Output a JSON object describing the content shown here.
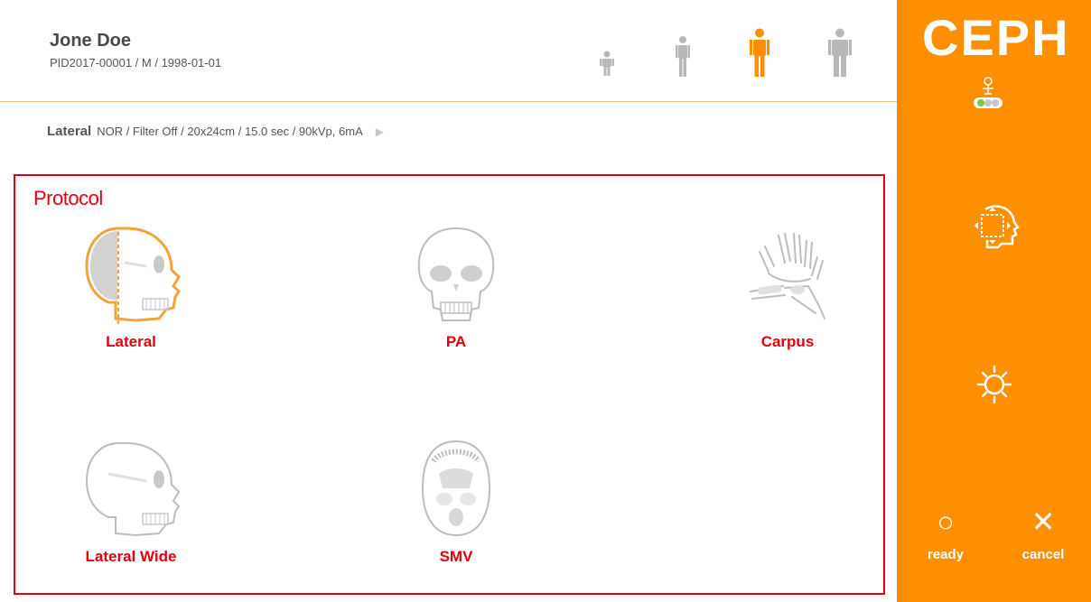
{
  "patient": {
    "name": "Jone Doe",
    "info": "PID2017-00001 / M / 1998-01-01"
  },
  "body_types": [
    {
      "name": "child",
      "selected": false
    },
    {
      "name": "small-adult",
      "selected": false
    },
    {
      "name": "adult",
      "selected": true
    },
    {
      "name": "large-adult",
      "selected": false
    }
  ],
  "exposure": {
    "mode": "Lateral",
    "details": "NOR / Filter Off / 20x24cm / 15.0 sec / 90kVp, 6mA",
    "arrow": "▶"
  },
  "protocol": {
    "title": "Protocol",
    "items": [
      {
        "label": "Lateral",
        "selected": true,
        "icon": "lateral-skull-icon"
      },
      {
        "label": "PA",
        "selected": false,
        "icon": "pa-skull-icon"
      },
      {
        "label": "Carpus",
        "selected": false,
        "icon": "hand-icon"
      },
      {
        "label": "Lateral Wide",
        "selected": false,
        "icon": "lateral-wide-skull-icon"
      },
      {
        "label": "SMV",
        "selected": false,
        "icon": "smv-skull-icon"
      }
    ]
  },
  "sidebar": {
    "mode_title": "CEPH",
    "ready_label": "ready",
    "cancel_label": "cancel",
    "ready_glyph": "○",
    "cancel_glyph": "✕"
  },
  "colors": {
    "accent": "#fd8f00",
    "highlight": "#e1000f",
    "icon_gray": "#b8b8b8"
  }
}
